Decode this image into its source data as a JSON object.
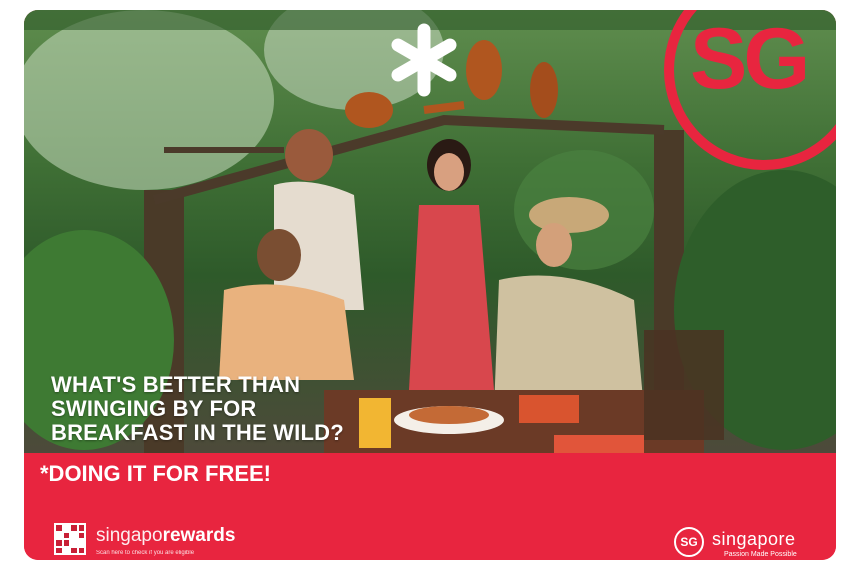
{
  "ad": {
    "headline": [
      "WHAT'S BETTER THAN",
      "SWINGING BY FOR",
      "BREAKFAST IN THE WILD?"
    ],
    "cta": "*DOING IT FOR FREE!",
    "brand_mark": "SG",
    "rewards": {
      "prefix": "singapo",
      "suffix": "rewards",
      "note": "Scan here to check if you are eligible"
    },
    "logo": {
      "mark": "SG",
      "word": "singapore",
      "tagline": "Passion Made Possible"
    }
  },
  "colors": {
    "brand_red": "#e8253f",
    "white": "#ffffff"
  },
  "icons": [
    "asterisk-icon",
    "qr-code-icon",
    "sg-logo-icon"
  ]
}
